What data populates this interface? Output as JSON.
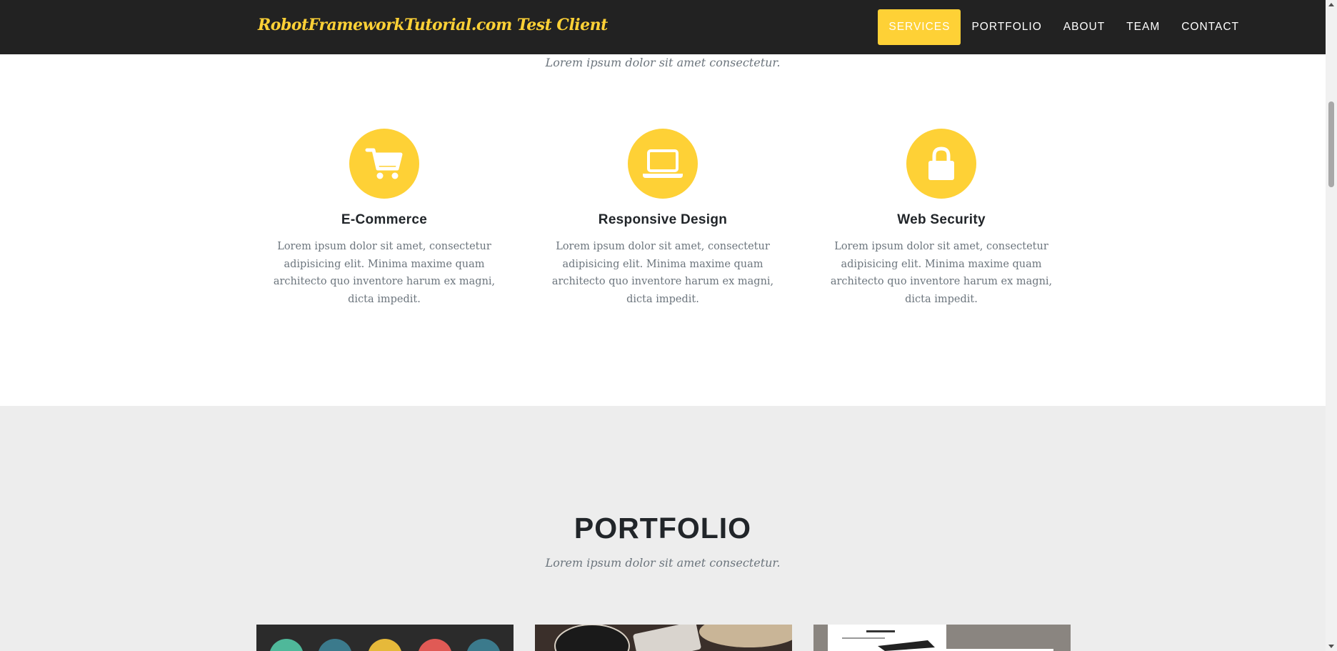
{
  "navbar": {
    "brand": "RobotFrameworkTutorial.com Test Client",
    "items": [
      {
        "label": "SERVICES",
        "active": true
      },
      {
        "label": "PORTFOLIO",
        "active": false
      },
      {
        "label": "ABOUT",
        "active": false
      },
      {
        "label": "TEAM",
        "active": false
      },
      {
        "label": "CONTACT",
        "active": false
      }
    ]
  },
  "services": {
    "subheading": "Lorem ipsum dolor sit amet consectetur.",
    "items": [
      {
        "icon": "shopping-cart-icon",
        "title": "E-Commerce",
        "text": "Lorem ipsum dolor sit amet, consectetur adipisicing elit. Minima maxime quam architecto quo inventore harum ex magni, dicta impedit."
      },
      {
        "icon": "laptop-icon",
        "title": "Responsive Design",
        "text": "Lorem ipsum dolor sit amet, consectetur adipisicing elit. Minima maxime quam architecto quo inventore harum ex magni, dicta impedit."
      },
      {
        "icon": "lock-icon",
        "title": "Web Security",
        "text": "Lorem ipsum dolor sit amet, consectetur adipisicing elit. Minima maxime quam architecto quo inventore harum ex magni, dicta impedit."
      }
    ]
  },
  "portfolio": {
    "heading": "PORTFOLIO",
    "subheading": "Lorem ipsum dolor sit amet consectetur."
  },
  "colors": {
    "accent": "#fed136",
    "navbar_bg": "#222222",
    "portfolio_bg": "#ededed",
    "heading": "#212529",
    "muted": "#6c757d"
  }
}
